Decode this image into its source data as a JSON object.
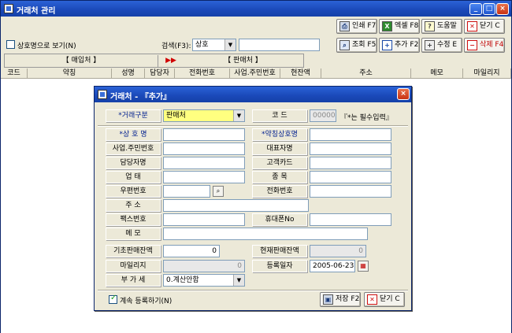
{
  "window": {
    "title": "거래처 관리",
    "controls": {
      "min": "_",
      "max": "□",
      "close": "×"
    }
  },
  "toolbar": {
    "print": "인쇄 F7",
    "excel": "엑셀 F8",
    "help": "도움말",
    "close": "닫기 C",
    "query": "조회 F5",
    "add": "추가 F2",
    "edit": "수정 E",
    "delete": "삭제 F4"
  },
  "filter": {
    "show_by_name_label": "상호명으로 보기(N)",
    "search_label": "검색(F3):",
    "search_field": "상호",
    "search_value": ""
  },
  "tabs": {
    "buy": "【 매입처 】",
    "arrow": "▶▶",
    "sell": "【 판매처 】"
  },
  "grid": {
    "columns": [
      "코드",
      "약칭",
      "성명",
      "담당자",
      "전화번호",
      "사업.주민번호",
      "현잔액",
      "주소",
      "메모",
      "마일리지"
    ]
  },
  "dialog": {
    "title": "거래처 - 『추가』",
    "close": "×",
    "note": "『*는 필수입력』",
    "fields": {
      "type_label": "*거래구분",
      "type_value": "판매처",
      "code_label": "코 드",
      "code_value": "000006",
      "name_label": "*상 호 명",
      "name_value": "",
      "short_label": "*약칭상호명",
      "short_value": "",
      "bizno_label": "사업.주민번호",
      "bizno_value": "",
      "rep_label": "대표자명",
      "rep_value": "",
      "staff_label": "담당자명",
      "staff_value": "",
      "card_label": "고객카드",
      "card_value": "",
      "biztype_label": "업 태",
      "biztype_value": "",
      "item_label": "종 목",
      "item_value": "",
      "zip_label": "우편번호",
      "zip_value": "",
      "phone_label": "전화번호",
      "phone_value": "",
      "addr_label": "주 소",
      "addr_value": "",
      "fax_label": "팩스번호",
      "fax_value": "",
      "mobile_label": "휴대폰No",
      "mobile_value": "",
      "memo_label": "메 모",
      "memo_value": "",
      "init_bal_label": "기초판매잔액",
      "init_bal_value": "0",
      "cur_bal_label": "현재판매잔액",
      "cur_bal_value": "0",
      "mileage_label": "마일리지",
      "mileage_value": "0",
      "regdate_label": "등록일자",
      "regdate_value": "2005-06-23",
      "vat_label": "부 가 세",
      "vat_value": "0.계산안함"
    },
    "continue_label": "계속 등록하기(N)",
    "save": "저장 F2",
    "close_btn": "닫기 C"
  }
}
